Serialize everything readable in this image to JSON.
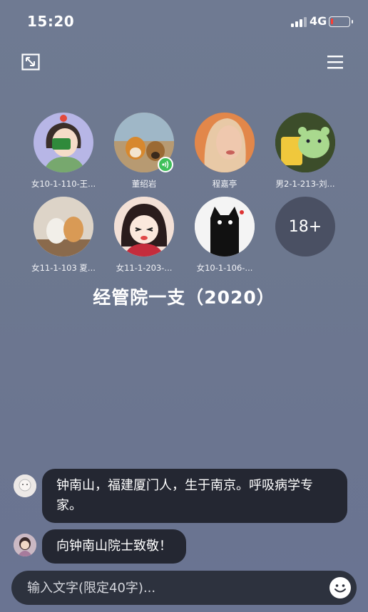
{
  "status": {
    "time": "15:20",
    "network": "4G"
  },
  "members": [
    {
      "name": "女10-1-110-王...",
      "avatar_icon": "cartoon-girl-avatar"
    },
    {
      "name": "董绍岩",
      "avatar_icon": "dogs-photo-avatar",
      "speaking": true
    },
    {
      "name": "程嘉亭",
      "avatar_icon": "portrait-photo-avatar"
    },
    {
      "name": "男2-1-213-刘...",
      "avatar_icon": "bear-drink-avatar"
    },
    {
      "name": "女11-1-103 夏...",
      "avatar_icon": "cats-photo-avatar"
    },
    {
      "name": "女11-1-203-...",
      "avatar_icon": "anime-girl-avatar"
    },
    {
      "name": "女10-1-106-...",
      "avatar_icon": "black-cat-avatar"
    }
  ],
  "more_count": "18+",
  "room_title": "经管院一支（2020）",
  "messages": [
    {
      "text": "钟南山，福建厦门人，生于南京。呼吸病学专家。"
    },
    {
      "text": "向钟南山院士致敬！"
    }
  ],
  "input": {
    "placeholder": "输入文字(限定40字)..."
  },
  "icons": {
    "minimize": "minimize-icon",
    "menu": "menu-icon",
    "emoji": "emoji-icon"
  }
}
